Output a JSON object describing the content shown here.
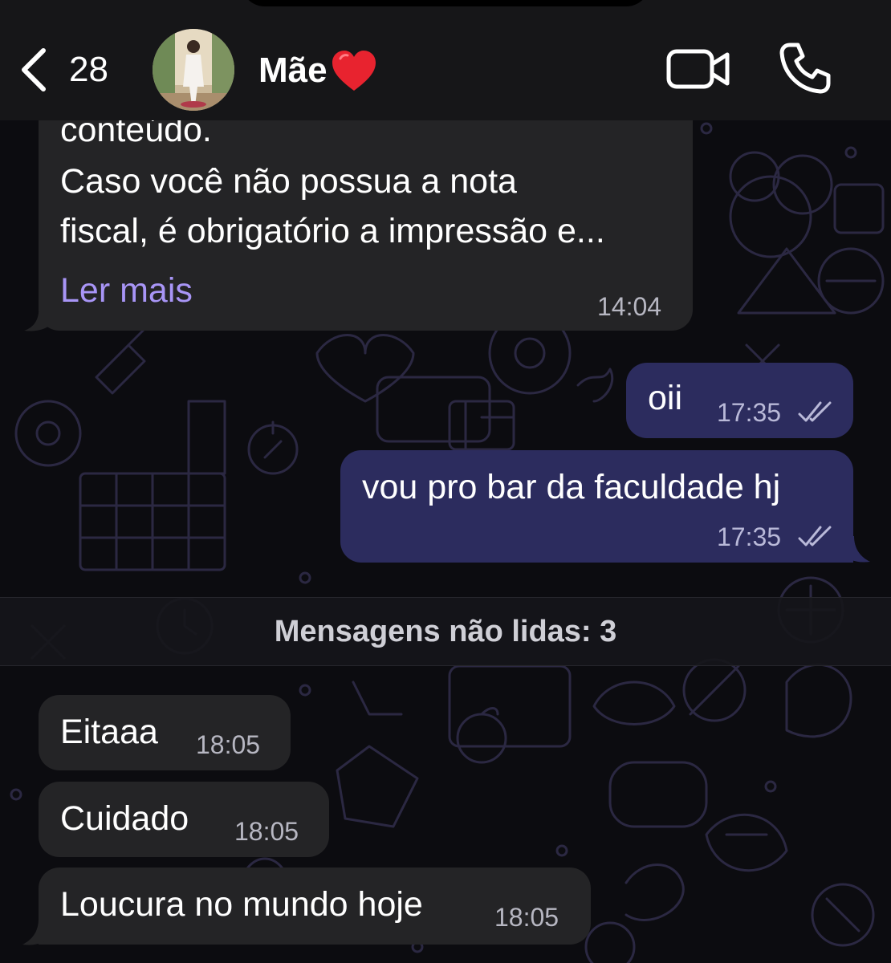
{
  "header": {
    "back_count": "28",
    "contact_name": "Mãe",
    "icons": [
      "back-chevron-icon",
      "heart-emoji",
      "video-camera-icon",
      "phone-icon"
    ]
  },
  "colors": {
    "accent_link": "#a895f6",
    "incoming_bubble": "#242426",
    "outgoing_bubble": "#2c2c5e",
    "background": "#0c0c10"
  },
  "messages": {
    "first": {
      "lines": [
        "conteúdo.",
        "Caso você não possua a nota",
        "fiscal, é obrigatório a impressão e..."
      ],
      "read_more": "Ler mais",
      "time": "14:04"
    },
    "out1": {
      "text": "oii",
      "time": "17:35"
    },
    "out2": {
      "text": "vou pro bar da faculdade hj",
      "time": "17:35"
    },
    "unread_label": "Mensagens não lidas: 3",
    "in1": {
      "text": "Eitaaa",
      "time": "18:05"
    },
    "in2": {
      "text": "Cuidado",
      "time": "18:05"
    },
    "in3": {
      "text": "Loucura no mundo hoje",
      "time": "18:05"
    }
  }
}
